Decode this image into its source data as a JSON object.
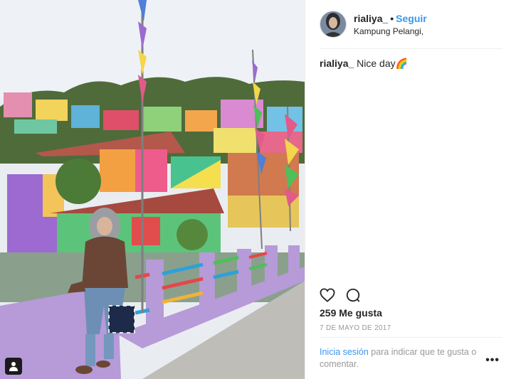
{
  "post": {
    "username": "rialiya_",
    "dot": "•",
    "follow_label": "Seguir",
    "location": "Kampung Pelangi,",
    "caption_user": "rialiya_",
    "caption_text": "Nice day🌈",
    "likes": "259 Me gusta",
    "date": "7 DE MAYO DE 2017",
    "login_link": "Inicia sesión",
    "login_rest": " para indicar que te gusta o comentar.",
    "more_label": "•••"
  },
  "icons": {
    "like": "heart-icon",
    "comment": "comment-icon",
    "tagged": "user-tag-icon",
    "more": "more-options-icon"
  },
  "colors": {
    "accent": "#3897f0",
    "muted": "#999999",
    "text": "#262626",
    "divider": "#efefef"
  }
}
